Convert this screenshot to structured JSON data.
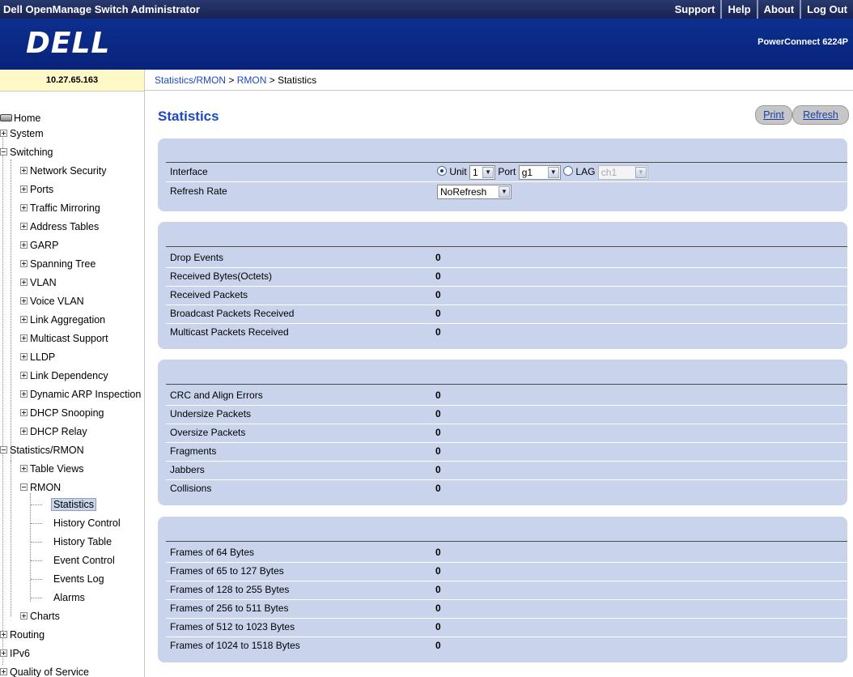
{
  "app": {
    "title": "Dell OpenManage Switch Administrator",
    "links": [
      "Support",
      "Help",
      "About",
      "Log Out"
    ],
    "logo": "DELL",
    "product": "PowerConnect 6224P",
    "ip": "10.27.65.163"
  },
  "breadcrumb": {
    "part1": "Statistics/RMON",
    "sep1": " > ",
    "part2": "RMON",
    "sep2": " > ",
    "current": "Statistics"
  },
  "sidebar": {
    "items": [
      "Home",
      "System",
      "Switching",
      "Network Security",
      "Ports",
      "Traffic Mirroring",
      "Address Tables",
      "GARP",
      "Spanning Tree",
      "VLAN",
      "Voice VLAN",
      "Link Aggregation",
      "Multicast Support",
      "LLDP",
      "Link Dependency",
      "Dynamic ARP Inspection",
      "DHCP Snooping",
      "DHCP Relay",
      "Statistics/RMON",
      "Table Views",
      "RMON",
      "Statistics",
      "History Control",
      "History Table",
      "Event Control",
      "Events Log",
      "Alarms",
      "Charts",
      "Routing",
      "IPv6",
      "Quality of Service"
    ]
  },
  "main": {
    "title": "Statistics",
    "print": "Print",
    "refresh": "Refresh",
    "interface_label": "Interface",
    "unit_label": "Unit",
    "unit_value": "1",
    "port_label": "Port",
    "port_value": "g1",
    "lag_label": "LAG",
    "lag_value": "ch1",
    "refresh_rate_label": "Refresh Rate",
    "refresh_rate_value": "NoRefresh",
    "group1": [
      {
        "label": "Drop Events",
        "value": "0"
      },
      {
        "label": "Received Bytes(Octets)",
        "value": "0"
      },
      {
        "label": "Received Packets",
        "value": "0"
      },
      {
        "label": "Broadcast Packets Received",
        "value": "0"
      },
      {
        "label": "Multicast Packets Received",
        "value": "0"
      }
    ],
    "group2": [
      {
        "label": "CRC and Align Errors",
        "value": "0"
      },
      {
        "label": "Undersize Packets",
        "value": "0"
      },
      {
        "label": "Oversize Packets",
        "value": "0"
      },
      {
        "label": "Fragments",
        "value": "0"
      },
      {
        "label": "Jabbers",
        "value": "0"
      },
      {
        "label": "Collisions",
        "value": "0"
      }
    ],
    "group3": [
      {
        "label": "Frames of 64 Bytes",
        "value": "0"
      },
      {
        "label": "Frames of 65 to 127 Bytes",
        "value": "0"
      },
      {
        "label": "Frames of 128 to 255 Bytes",
        "value": "0"
      },
      {
        "label": "Frames of 256 to 511 Bytes",
        "value": "0"
      },
      {
        "label": "Frames of 512 to 1023 Bytes",
        "value": "0"
      },
      {
        "label": "Frames of 1024 to 1518 Bytes",
        "value": "0"
      }
    ]
  }
}
